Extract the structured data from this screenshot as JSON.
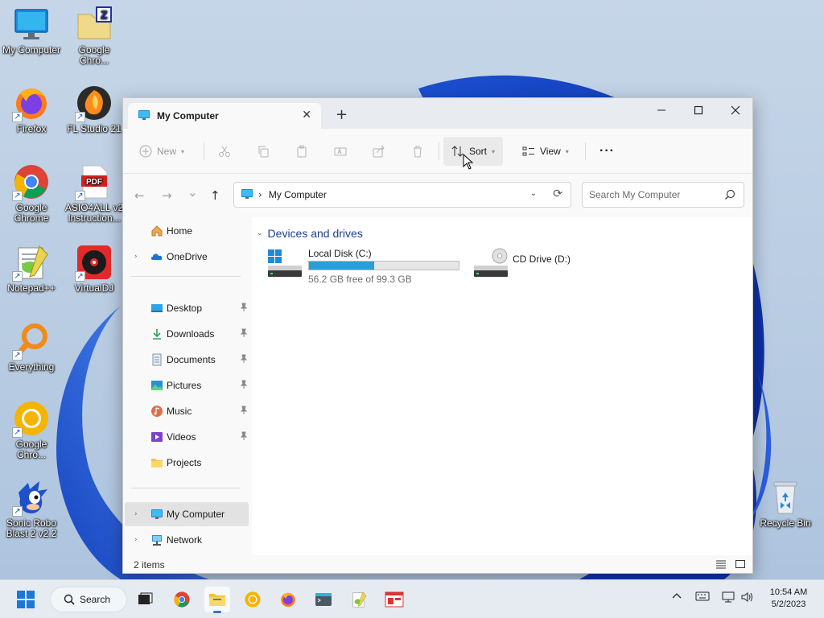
{
  "desktop": {
    "icons": [
      {
        "label": "My Computer"
      },
      {
        "label": "Google Chro..."
      },
      {
        "label": "Firefox"
      },
      {
        "label": "FL Studio 21"
      },
      {
        "label": "Google Chrome"
      },
      {
        "label": "ASIO4ALL v2 Instruction..."
      },
      {
        "label": "Notepad++"
      },
      {
        "label": "VirtualDJ"
      },
      {
        "label": "Everything"
      },
      {
        "label": "Google Chro..."
      },
      {
        "label": "Sonic Robo Blast 2 v2.2"
      },
      {
        "label": "Recycle Bin"
      }
    ],
    "pdf_text": "PDF",
    "zip_text": "Z"
  },
  "window": {
    "tab_title": "My Computer",
    "new_tab": "+",
    "tab_close": "✕"
  },
  "toolbar": {
    "new_label": "New",
    "sort_label": "Sort",
    "view_label": "View",
    "more_label": "···"
  },
  "nav": {
    "back": "←",
    "forward": "→",
    "recent": "⌄",
    "up": "↑",
    "crumb_sep": "›",
    "address": "My Computer",
    "search_placeholder": "Search My Computer"
  },
  "sidebar": {
    "items": [
      {
        "label": "Home"
      },
      {
        "label": "OneDrive"
      },
      {
        "label": "Desktop"
      },
      {
        "label": "Downloads"
      },
      {
        "label": "Documents"
      },
      {
        "label": "Pictures"
      },
      {
        "label": "Music"
      },
      {
        "label": "Videos"
      },
      {
        "label": "Projects"
      },
      {
        "label": "My Computer"
      },
      {
        "label": "Network"
      }
    ]
  },
  "content": {
    "group_title": "Devices and drives",
    "drives": [
      {
        "name": "Local Disk (C:)",
        "free_text": "56.2 GB free of 99.3 GB",
        "used_fraction": 0.434
      },
      {
        "name": "CD Drive (D:)"
      }
    ]
  },
  "status": {
    "item_count": "2 items"
  },
  "taskbar": {
    "search_label": "Search",
    "time": "10:54 AM",
    "date": "5/2/2023"
  },
  "colors": {
    "accent": "#26a0da",
    "group_header": "#1d3d8f",
    "taskbar_bg": "#e6ebf2"
  }
}
